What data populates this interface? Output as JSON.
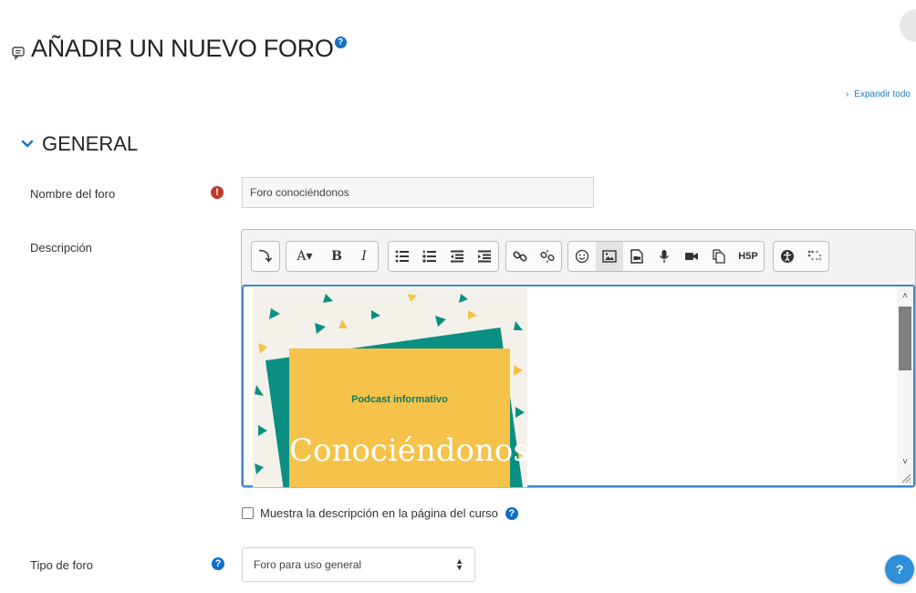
{
  "page": {
    "title": "AÑADIR UN NUEVO FORO",
    "title_help_glyph": "?",
    "expand_all": "Expandir todo"
  },
  "section": {
    "title": "GENERAL"
  },
  "form": {
    "forum_name": {
      "label": "Nombre del foro",
      "value": "Foro conociéndonos",
      "required_glyph": "!"
    },
    "description": {
      "label": "Descripción"
    },
    "show_description": {
      "label": "Muestra la descripción en la página del curso",
      "checked": false,
      "help_glyph": "?"
    },
    "forum_type": {
      "label": "Tipo de foro",
      "selected": "Foro para uso general",
      "help_glyph": "?"
    }
  },
  "editor": {
    "toolbar": {
      "toggle": "⤵",
      "font_style": "A▾",
      "bold": "B",
      "italic": "I",
      "h5p": "H5P"
    },
    "image": {
      "subtitle": "Podcast informativo",
      "title": "Conociéndonos"
    }
  },
  "floating_help": {
    "glyph": "?"
  },
  "colors": {
    "accent_blue": "#0f6fc5",
    "required_red": "#c0392b",
    "image_yellow": "#f5c24a",
    "image_teal": "#0b8f82"
  }
}
